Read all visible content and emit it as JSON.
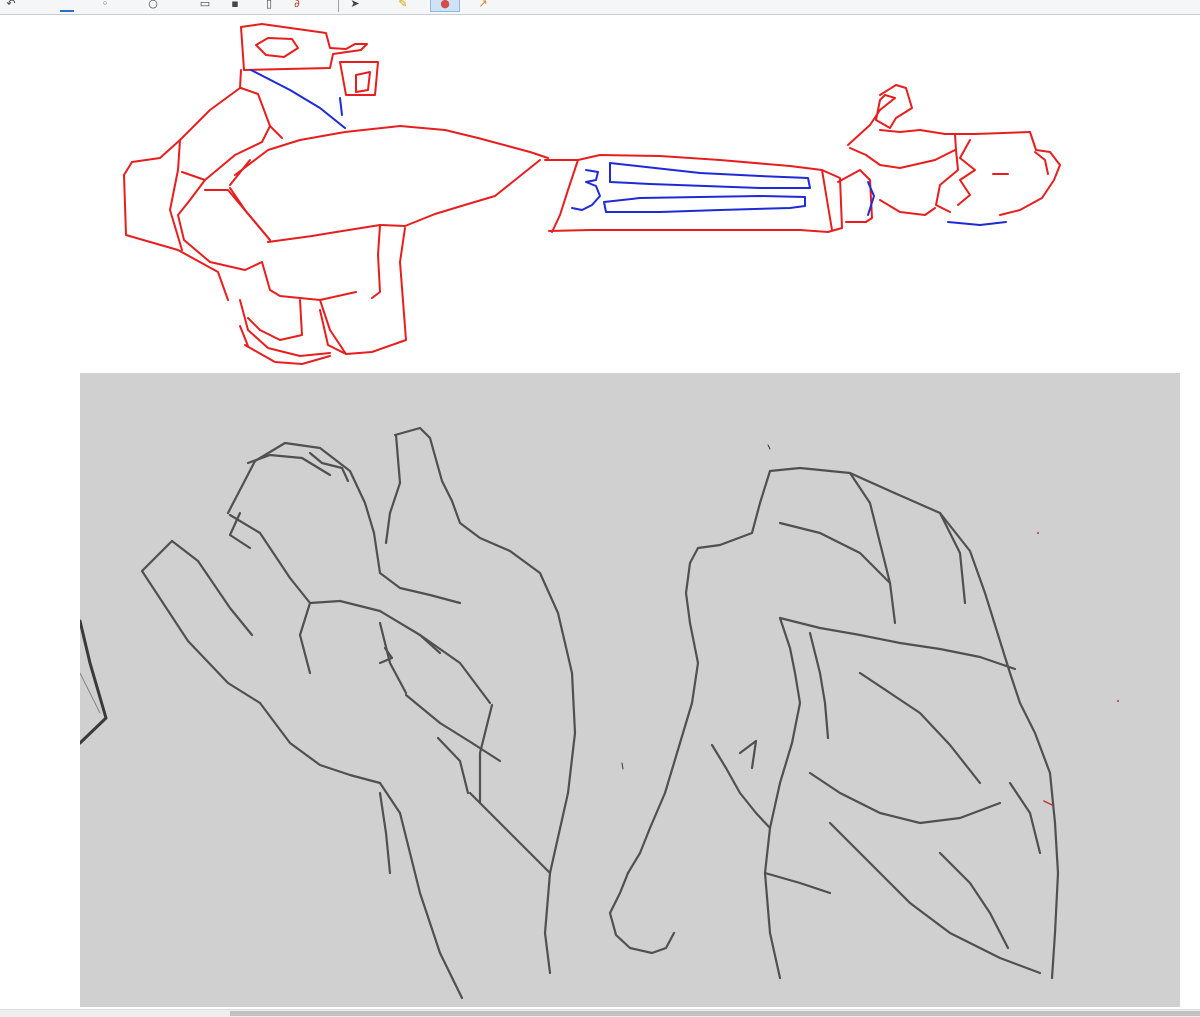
{
  "toolbar": {
    "buttons": [
      {
        "icon": "undo-icon"
      },
      {
        "icon": "save-icon"
      },
      {
        "icon": "brush-icon"
      },
      {
        "icon": "circle-icon"
      },
      {
        "icon": "layer-icon"
      },
      {
        "icon": "document-icon"
      },
      {
        "icon": "link-icon"
      },
      {
        "icon": "select-icon"
      },
      {
        "icon": "pencil-icon"
      },
      {
        "icon": "color-icon",
        "active": true
      },
      {
        "icon": "shape-icon"
      }
    ]
  },
  "colors": {
    "stroke_red": "#e81e1e",
    "stroke_blue": "#1e2ad8",
    "reference_bg": "#d0d0d0",
    "pencil": "#3a3a3a"
  }
}
